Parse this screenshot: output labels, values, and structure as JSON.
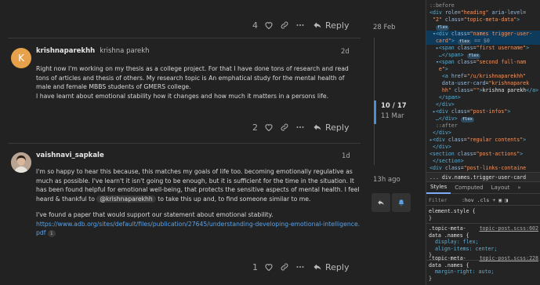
{
  "forum": {
    "top_actions": {
      "like_count": "4",
      "reply_label": "Reply"
    },
    "posts": [
      {
        "username": "krishnaparekhh",
        "fullname": "krishna parekh",
        "avatar_letter": "K",
        "avatar_color": "#e6a14a",
        "date": "2d",
        "paragraphs": [
          "Right now I'm working on my thesis as a college project. For that I have done tons of research and read tons of articles and thesis of others. My research topic is An emphatical study for the mental health of male and female MBBS students of GMERS college.",
          "I have learnt about emotional stability how it changes and how much it matters in a persons life."
        ],
        "like_count": "2",
        "reply_label": "Reply"
      },
      {
        "username": "vaishnavi_sapkale",
        "date": "1d",
        "paragraph1_before": "I'm so happy to hear this because, this matches my goals of life too. becoming emotionally regulative as much as possible. I've learn't it isn't going to be enough, but it is sufficient for the time in the situation. It has been found helpful for emotional well-being, that protects the sensitive aspects of mental health. I feel heard & thankful to",
        "mention": "@krishnaparekhh",
        "paragraph1_after": "to take this up and, to find someone similar to me.",
        "paragraph2": "I've found a paper that would support our statement about emotional stability.",
        "link": "https://www.adb.org/sites/default/files/publication/27645/understanding-developing-emotional-intelligence.pdf",
        "link_clicks": "1",
        "like_count": "1",
        "reply_label": "Reply"
      }
    ]
  },
  "timeline": {
    "top_date": "28 Feb",
    "counter": "10 / 17",
    "counter_date": "11 Mar",
    "bottom_date": "13h ago"
  },
  "devtools": {
    "dom_lines": [
      {
        "html": "<span class='pseudo'>::before</span>"
      },
      {
        "html": "<span class='tag'>&lt;div</span> <span class='attr'>role</span>=<span class='val'>\"heading\"</span> <span class='attr'>aria-level</span>="
      },
      {
        "html": "&nbsp;<span class='val'>\"2\"</span> <span class='attr'>class</span>=<span class='val'>\"topic-meta-data\"</span><span class='tag'>&gt;</span>"
      },
      {
        "html": "&nbsp;&nbsp;<span class='badge'>flex</span>"
      },
      {
        "html": "&nbsp;<span class='tag'>▾&lt;div</span> <span class='attr'>class</span>=<span class='val'>\"names trigger-user-</span>",
        "selected": true
      },
      {
        "html": "&nbsp;&nbsp;<span class='val'>card\"</span><span class='tag'>&gt;</span> <span class='badge'>flex</span> <span class='pseudo'>== $0</span>"
      },
      {
        "html": "&nbsp;&nbsp;<span class='tag'>▸&lt;span</span> <span class='attr'>class</span>=<span class='val'>\"first username\"</span><span class='tag'>&gt;</span>"
      },
      {
        "html": "&nbsp;&nbsp;&nbsp;<span class='tag'>…&lt;/span&gt;</span> <span class='badge'>flex</span>"
      },
      {
        "html": "&nbsp;&nbsp;<span class='tag'>▾&lt;span</span> <span class='attr'>class</span>=<span class='val'>\"second full-nam</span>"
      },
      {
        "html": "&nbsp;&nbsp;&nbsp;<span class='val'>e\"</span><span class='tag'>&gt;</span>"
      },
      {
        "html": "&nbsp;&nbsp;&nbsp;&nbsp;<span class='tag'>&lt;a</span> <span class='attr'>href</span>=<span class='val'>\"/u/krishnaparekhh\"</span>"
      },
      {
        "html": "&nbsp;&nbsp;&nbsp;&nbsp;<span class='attr'>data-user-card</span>=<span class='val'>\"krishnaparek</span>"
      },
      {
        "html": "&nbsp;&nbsp;&nbsp;&nbsp;<span class='val'>hh\"</span> <span class='attr'>class</span>=<span class='val'>\"\"</span><span class='tag'>&gt;</span><span class='txt'>krishna parekh</span><span class='tag'>&lt;/a&gt;</span>"
      },
      {
        "html": "&nbsp;&nbsp;&nbsp;<span class='tag'>&lt;/span&gt;</span>"
      },
      {
        "html": "&nbsp;&nbsp;<span class='tag'>&lt;/div&gt;</span>"
      },
      {
        "html": "&nbsp;<span class='tag'>▸&lt;div</span> <span class='attr'>class</span>=<span class='val'>\"post-infos\"</span><span class='tag'>&gt;</span>"
      },
      {
        "html": "&nbsp;&nbsp;<span class='tag'>…&lt;/div&gt;</span> <span class='badge'>flex</span>"
      },
      {
        "html": "&nbsp;&nbsp;<span class='pseudo'>::after</span>"
      },
      {
        "html": "&nbsp;<span class='tag'>&lt;/div&gt;</span>"
      },
      {
        "html": "<span class='tag'>▸&lt;div</span> <span class='attr'>class</span>=<span class='val'>\"regular contents\"</span><span class='tag'>&gt;</span>"
      },
      {
        "html": "&nbsp;<span class='tag'>&lt;/div&gt;</span>"
      },
      {
        "html": "<span class='tag'>&lt;section</span> <span class='attr'>class</span>=<span class='val'>\"post-actions\"</span><span class='tag'>&gt;</span>"
      },
      {
        "html": "&nbsp;<span class='tag'>&lt;/section&gt;</span>"
      },
      {
        "html": "<span class='tag'>&lt;div</span> <span class='attr'>class</span>=<span class='val'>\"post-links-containe</span>"
      }
    ],
    "breadcrumb_prev": "...",
    "breadcrumb_selected": "div.names.trigger-user-card",
    "tabs": [
      "Styles",
      "Computed",
      "Layout",
      "»"
    ],
    "filter_placeholder": "Filter",
    "filter_hov": ":hov",
    "filter_cls": ".cls",
    "rules": [
      {
        "selector": "element.style {",
        "source": "",
        "props": [
          "}"
        ]
      },
      {
        "selector": ".topic-meta-",
        "source": "topic-post.scss:602",
        "sel2": "data .names {",
        "props": [
          "display: flex;",
          "align-items: center;"
        ],
        "close": "}"
      },
      {
        "selector": ".topic-meta-",
        "source": "topic-post.scss:228",
        "sel2": "data .names {",
        "props": [
          "margin-right: auto;"
        ],
        "close": "}"
      }
    ]
  }
}
